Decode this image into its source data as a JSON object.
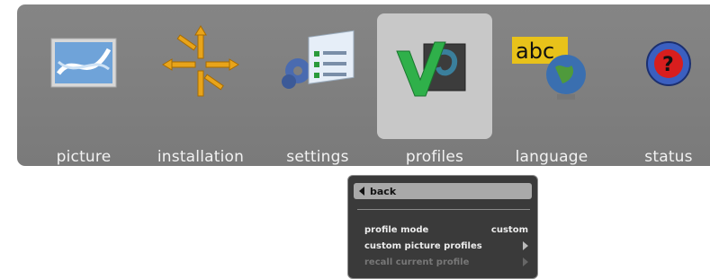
{
  "menu": {
    "items": [
      {
        "label": "picture",
        "icon": "picture-icon"
      },
      {
        "label": "installation",
        "icon": "installation-icon"
      },
      {
        "label": "settings",
        "icon": "settings-icon"
      },
      {
        "label": "profiles",
        "icon": "profiles-icon",
        "selected": true
      },
      {
        "label": "language",
        "icon": "language-icon"
      },
      {
        "label": "status",
        "icon": "status-icon"
      }
    ]
  },
  "popup": {
    "back_label": "back",
    "rows": [
      {
        "label": "profile mode",
        "value": "custom"
      },
      {
        "label": "custom picture profiles"
      },
      {
        "label": "recall current profile",
        "disabled": true
      }
    ]
  },
  "language_icon_text": "abc",
  "colors": {
    "menu_bg": "#7f7f7f",
    "selected_bg": "#c8c8c8",
    "popup_bg": "#3a3a3a"
  }
}
